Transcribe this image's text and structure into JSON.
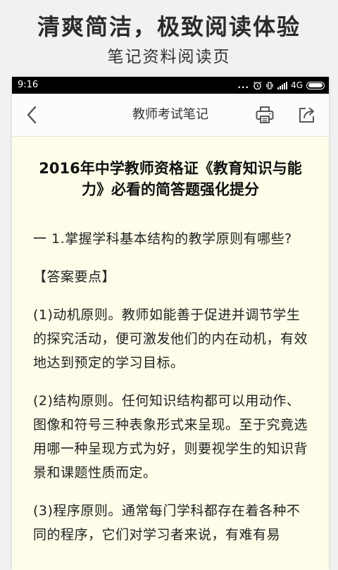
{
  "promo": {
    "title": "清爽简洁，极致阅读体验",
    "subtitle": "笔记资料阅读页"
  },
  "status_bar": {
    "time": "9:16",
    "dots": "...",
    "network": "4G",
    "icons": [
      "alarm-icon",
      "vibrate-icon",
      "signal-icon",
      "battery-icon"
    ]
  },
  "nav": {
    "title": "教师考试笔记",
    "icons": [
      "back-chevron-icon",
      "print-icon",
      "share-icon"
    ]
  },
  "article": {
    "title": "2016年中学教师资格证《教育知识与能力》必看的简答题强化提分",
    "question": "一 1.掌握学科基本结构的教学原则有哪些?",
    "answer_header": "【答案要点】",
    "paragraphs": [
      "(1)动机原则。教师如能善于促进并调节学生的探究活动，便可激发他们的内在动机，有效地达到预定的学习目标。",
      "(2)结构原则。任何知识结构都可以用动作、图像和符号三种表象形式来呈现。至于究竟选用哪一种呈现方式为好，则要视学生的知识背景和课题性质而定。",
      "(3)程序原则。通常每门学科都存在着各种不同的程序，它们对学习者来说，有难有易"
    ]
  },
  "colors": {
    "page_background": "#f1f1f1",
    "reader_background": "#fdfde9",
    "status_bar": "#000000",
    "nav_bar": "#fcfcfc",
    "text": "#222222"
  }
}
